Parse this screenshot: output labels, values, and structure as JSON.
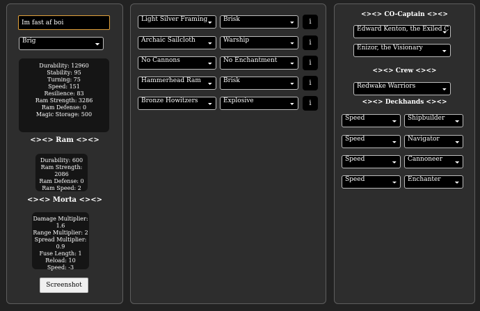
{
  "left": {
    "ship_name": "Im fast af boi",
    "ship_type": "Brig",
    "ship_stats": [
      "Durability: 12960",
      "Stability: 95",
      "Turning: 75",
      "Speed: 151",
      "Resilience: 83",
      "Ram Strength: 3286",
      "Ram Defense: 0",
      "Magic Storage: 500"
    ],
    "ram_title": "<><> Ram <><>",
    "ram_stats": [
      "Durability: 600",
      "Ram Strength:",
      "2086",
      "Ram Defense: 0",
      "Ram Speed: 2"
    ],
    "morta_title": "<><> Morta <><>",
    "morta_stats": [
      "Damage Multiplier:",
      "1.6",
      "Range Multiplier: 2",
      "Spread Multiplier:",
      "0.9",
      "Fuse Length: 1",
      "Reload: 10",
      "Speed: -3"
    ],
    "screenshot_label": "Screenshot"
  },
  "mid": {
    "rows": [
      {
        "item": "Light Silver Framing",
        "mod": "Brisk"
      },
      {
        "item": "Archaic Sailcloth",
        "mod": "Warship"
      },
      {
        "item": "No Cannons",
        "mod": "No Enchantment"
      },
      {
        "item": "Hammerhead Ram",
        "mod": "Brisk"
      },
      {
        "item": "Bronze Howitzers",
        "mod": "Explosive"
      }
    ],
    "info_label": "i"
  },
  "right": {
    "cocaptain_title": "<><> CO-Captain <><>",
    "cocaptain_1": "Edward Kenton, the Exiled C",
    "cocaptain_2": "Enizor, the Visionary",
    "crew_title": "<><> Crew <><>",
    "crew": "Redwake Warriors",
    "deckhands_title": "<><> Deckhands <><>",
    "deckhands": [
      {
        "stat": "Speed",
        "role": "Shipbuilder"
      },
      {
        "stat": "Speed",
        "role": "Navigator"
      },
      {
        "stat": "Speed",
        "role": "Cannoneer"
      },
      {
        "stat": "Speed",
        "role": "Enchanter"
      }
    ]
  }
}
